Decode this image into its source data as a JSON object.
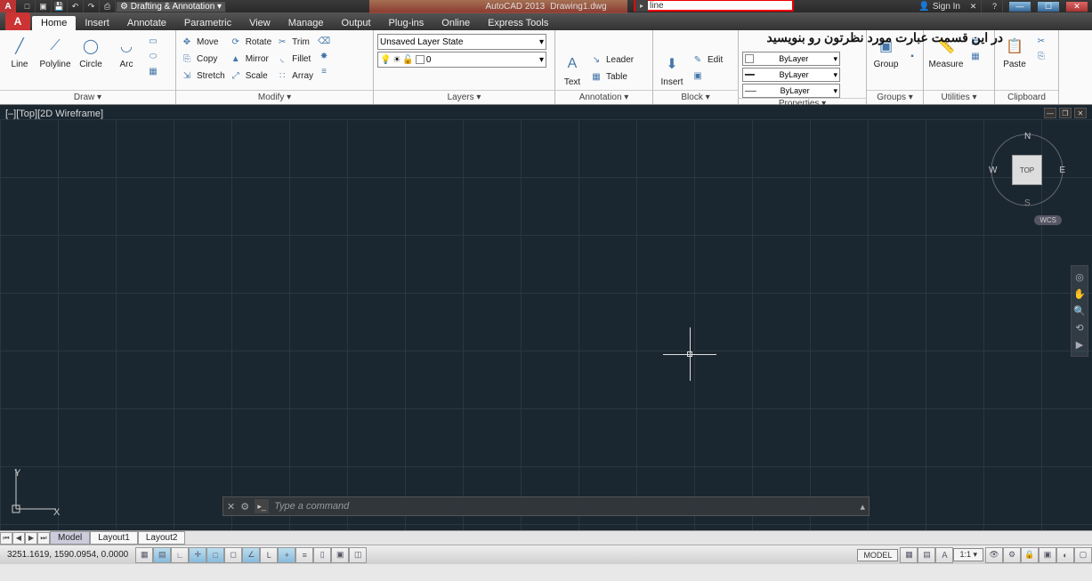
{
  "title": {
    "app": "AutoCAD 2013",
    "doc": "Drawing1.dwg",
    "workspace": "Drafting & Annotation",
    "search_value": "line",
    "signin": "Sign In"
  },
  "tabs": {
    "items": [
      "Home",
      "Insert",
      "Annotate",
      "Parametric",
      "View",
      "Manage",
      "Output",
      "Plug-ins",
      "Online",
      "Express Tools"
    ],
    "active": 0
  },
  "ribbon": {
    "draw": {
      "title": "Draw ▾",
      "line": "Line",
      "polyline": "Polyline",
      "circle": "Circle",
      "arc": "Arc"
    },
    "modify": {
      "title": "Modify ▾",
      "move": "Move",
      "copy": "Copy",
      "stretch": "Stretch",
      "rotate": "Rotate",
      "mirror": "Mirror",
      "scale": "Scale",
      "trim": "Trim",
      "fillet": "Fillet",
      "array": "Array"
    },
    "layers": {
      "title": "Layers ▾",
      "state": "Unsaved Layer State",
      "current": "0"
    },
    "annotation": {
      "title": "Annotation ▾",
      "text": "Text",
      "leader": "Leader",
      "table": "Table",
      "overlay_msg": "در این قسمت عبارت مورد نظرتون رو بنویسید"
    },
    "block": {
      "title": "Block ▾",
      "insert": "Insert",
      "edit": "Edit"
    },
    "properties": {
      "title": "Properties ▾",
      "bylayer": "ByLayer"
    },
    "groups": {
      "title": "Groups ▾",
      "group": "Group"
    },
    "utilities": {
      "title": "Utilities ▾",
      "measure": "Measure"
    },
    "clipboard": {
      "title": "Clipboard",
      "paste": "Paste"
    }
  },
  "viewport": {
    "label": "[–][Top][2D Wireframe]",
    "viewcube_face": "TOP",
    "wcs": "WCS",
    "n": "N",
    "s": "S",
    "e": "E",
    "w": "W",
    "ucs_y": "Y",
    "ucs_x": "X"
  },
  "cmdline": {
    "placeholder": "Type a command"
  },
  "layout_tabs": {
    "items": [
      "Model",
      "Layout1",
      "Layout2"
    ],
    "active": 0
  },
  "status": {
    "coords": "3251.1619, 1590.0954, 0.0000",
    "model": "MODEL",
    "scale": "1:1"
  }
}
